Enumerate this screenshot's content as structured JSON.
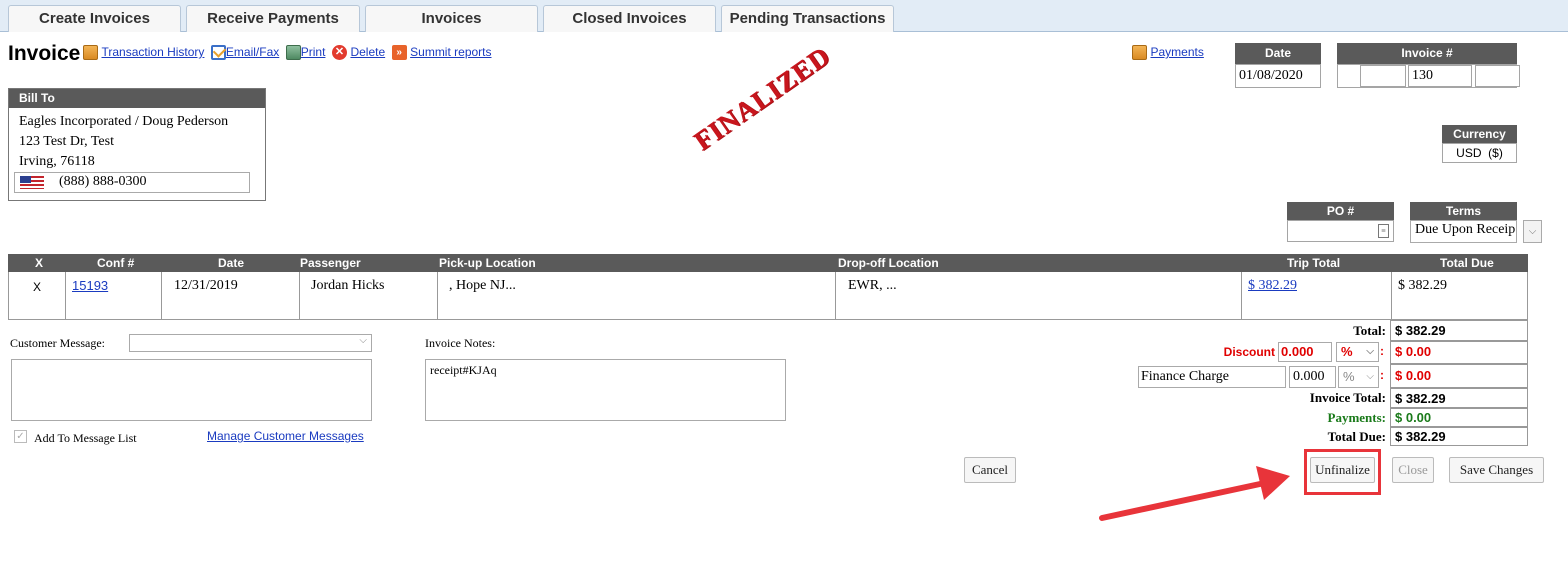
{
  "tabs": [
    {
      "label": "Create Invoices"
    },
    {
      "label": "Receive Payments"
    },
    {
      "label": "Invoices"
    },
    {
      "label": "Closed Invoices"
    },
    {
      "label": "Pending Transactions"
    }
  ],
  "header": {
    "title": "Invoice",
    "links": {
      "transaction_history": "Transaction History",
      "email_fax": "Email/Fax",
      "print": "Print",
      "delete": "Delete",
      "summit_reports": "Summit reports",
      "payments": "Payments"
    },
    "date_label": "Date",
    "date_value": "01/08/2020",
    "invoice_label": "Invoice #",
    "invoice_value": "130",
    "currency_label": "Currency",
    "currency_value": "USD  ($)",
    "po_label": "PO #",
    "po_value": "",
    "terms_label": "Terms",
    "terms_value": "Due Upon Receip"
  },
  "bill_to": {
    "label": "Bill To",
    "line1": "Eagles Incorporated / Doug Pederson",
    "line2": "123 Test Dr, Test",
    "line3": "Irving,  76118",
    "phone": "(888) 888-0300"
  },
  "stamp": "FINALIZED",
  "table": {
    "headers": [
      "X",
      "Conf #",
      "Date",
      "Passenger",
      "Pick-up Location",
      "Drop-off Location",
      "Trip Total",
      "Total Due"
    ],
    "rows": [
      {
        "x": "X",
        "conf": "15193",
        "date": "12/31/2019",
        "passenger": "Jordan Hicks",
        "pickup": ", Hope NJ...",
        "dropoff": "EWR,  ...",
        "trip_total": "$ 382.29",
        "total_due": "$ 382.29"
      }
    ]
  },
  "messages": {
    "customer_message_label": "Customer Message:",
    "customer_message_value": "",
    "invoice_notes_label": "Invoice Notes:",
    "invoice_notes_value": "receipt#KJAq",
    "add_to_list_label": "Add To Message List",
    "manage_link": "Manage Customer Messages"
  },
  "totals": {
    "total_label": "Total:",
    "total_value": "$ 382.29",
    "discount_label": "Discount",
    "discount_amount": "0.000",
    "discount_unit": "%",
    "discount_value": "$ 0.00",
    "finance_label": "Finance Charge",
    "finance_amount": "0.000",
    "finance_unit": "%",
    "finance_value": "$ 0.00",
    "invoice_total_label": "Invoice Total:",
    "invoice_total_value": "$ 382.29",
    "payments_label": "Payments:",
    "payments_value": "$ 0.00",
    "total_due_label": "Total Due:",
    "total_due_value": "$ 382.29"
  },
  "buttons": {
    "cancel": "Cancel",
    "unfinalize": "Unfinalize",
    "close": "Close",
    "save": "Save Changes"
  },
  "colors": {
    "header_bg": "#5a5a5a",
    "stamp_red": "#c8161d",
    "discount_red": "#e00000",
    "payments_green": "#1a7a1a",
    "highlight_red": "#e8343a"
  }
}
